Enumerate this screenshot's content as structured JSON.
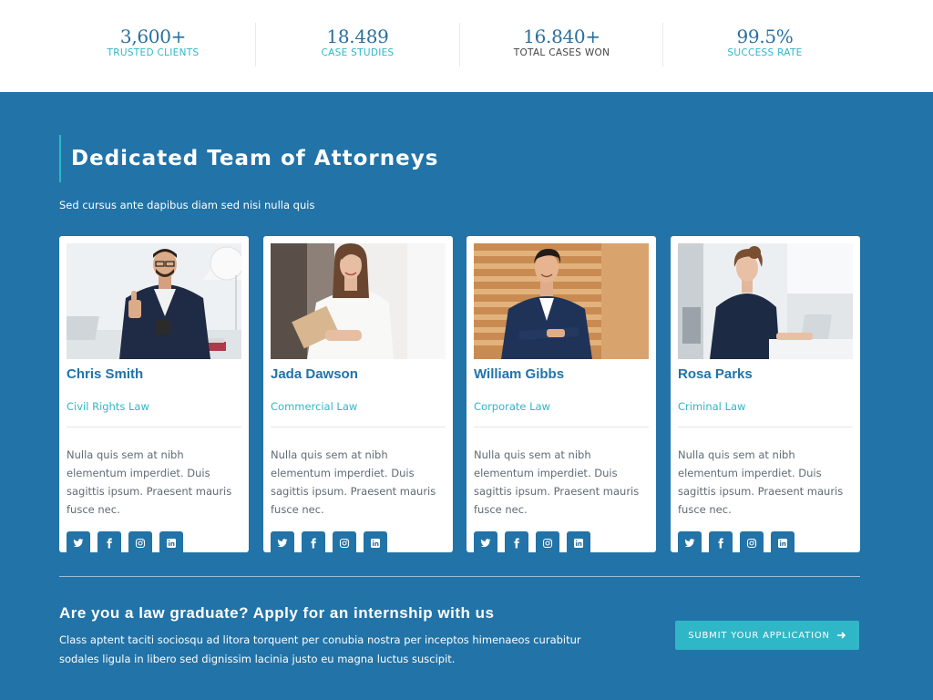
{
  "stats": [
    {
      "value": "3,600+",
      "label": "TRUSTED CLIENTS"
    },
    {
      "value": "18.489",
      "label": "CASE STUDIES"
    },
    {
      "value": "16.840+",
      "label": "TOTAL CASES WON"
    },
    {
      "value": "99.5%",
      "label": "SUCCESS RATE"
    }
  ],
  "team": {
    "title": "Dedicated Team of Attorneys",
    "subtitle": "Sed cursus ante dapibus diam sed nisi nulla quis",
    "members": [
      {
        "name": "Chris Smith",
        "practice": "Civil Rights Law",
        "bio": "Nulla quis sem at nibh elementum imperdiet. Duis sagittis ipsum. Praesent mauris fusce nec."
      },
      {
        "name": "Jada Dawson",
        "practice": "Commercial Law",
        "bio": "Nulla quis sem at nibh elementum imperdiet. Duis sagittis ipsum. Praesent mauris fusce nec."
      },
      {
        "name": "William Gibbs",
        "practice": "Corporate Law",
        "bio": "Nulla quis sem at nibh elementum imperdiet. Duis sagittis ipsum. Praesent mauris fusce nec."
      },
      {
        "name": "Rosa Parks",
        "practice": "Criminal Law",
        "bio": "Nulla quis sem at nibh elementum imperdiet. Duis sagittis ipsum. Praesent mauris fusce nec."
      }
    ],
    "social_icons": [
      "twitter-icon",
      "facebook-icon",
      "instagram-icon",
      "linkedin-icon"
    ]
  },
  "cta": {
    "title": "Are you a law graduate? Apply for an internship with us",
    "text": "Class aptent taciti sociosqu ad litora torquent per conubia nostra per inceptos himenaeos curabitur sodales ligula in libero sed dignissim lacinia justo eu magna luctus suscipit.",
    "button_label": "SUBMIT YOUR APPLICATION",
    "button_icon": "arrow-right-icon"
  },
  "colors": {
    "primary": "#2273a7",
    "accent": "#2fb7c8",
    "stat_value": "#2b6f9e"
  }
}
